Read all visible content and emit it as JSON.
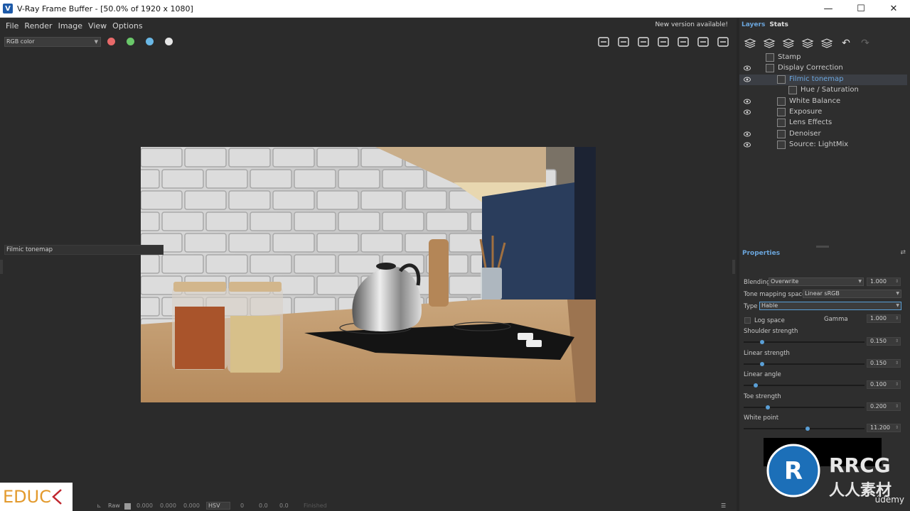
{
  "window": {
    "title": "V-Ray Frame Buffer - [50.0% of 1920 x 1080]",
    "minimize": "—",
    "maximize": "☐",
    "close": "✕"
  },
  "menu": [
    "File",
    "Render",
    "Image",
    "View",
    "Options"
  ],
  "update_notice": "New version available!",
  "toolbar": {
    "channel": "RGB color",
    "channel_dots": [
      {
        "name": "red-channel-button",
        "color": "#e86a6a"
      },
      {
        "name": "green-channel-button",
        "color": "#6ac86a"
      },
      {
        "name": "blue-channel-button",
        "color": "#6ab8e6"
      },
      {
        "name": "alpha-channel-button",
        "color": "#e6e6e6"
      }
    ],
    "tools": [
      "save-icon",
      "clear-image-icon",
      "region-render-icon",
      "compare-icon",
      "render-icon",
      "interactive-render-icon",
      "stop-render-icon"
    ]
  },
  "statusbar": {
    "mode": "Raw",
    "v1": "0.000",
    "v2": "0.000",
    "v3": "0.000",
    "colorspace": "HSV",
    "h": "0",
    "s": "0.0",
    "v": "0.0",
    "status": "Finished"
  },
  "educ_logo": "EDUC",
  "panel": {
    "tabs": [
      "Layers",
      "Stats"
    ],
    "layer_tools": [
      "add-layer-icon",
      "delete-layer-icon",
      "save-layers-icon",
      "load-layers-icon",
      "layers-list-icon",
      "undo-icon",
      "redo-icon"
    ],
    "layers": [
      {
        "name": "Stamp",
        "visible": false,
        "indent": 0,
        "icon": "stamp-layer-icon"
      },
      {
        "name": "Display Correction",
        "visible": true,
        "indent": 0,
        "icon": "display-correction-icon"
      },
      {
        "name": "Filmic tonemap",
        "visible": true,
        "indent": 1,
        "icon": "filmic-tonemap-icon",
        "selected": true
      },
      {
        "name": "Hue / Saturation",
        "visible": false,
        "indent": 2,
        "icon": "hue-saturation-icon"
      },
      {
        "name": "White Balance",
        "visible": true,
        "indent": 1,
        "icon": "white-balance-icon"
      },
      {
        "name": "Exposure",
        "visible": true,
        "indent": 1,
        "icon": "exposure-icon"
      },
      {
        "name": "Lens Effects",
        "visible": false,
        "indent": 1,
        "icon": "lens-effects-icon"
      },
      {
        "name": "Denoiser",
        "visible": true,
        "indent": 1,
        "icon": "denoiser-icon"
      },
      {
        "name": "Source: LightMix",
        "visible": true,
        "indent": 1,
        "icon": "lightmix-icon"
      }
    ]
  },
  "properties": {
    "title": "Properties",
    "layer_name": "Filmic tonemap",
    "blending_label": "Blending",
    "blending_value": "Overwrite",
    "blending_amount": "1.000",
    "tone_space_label": "Tone mapping space",
    "tone_space_value": "Linear sRGB",
    "type_label": "Type",
    "type_value": "Hable",
    "log_space_label": "Log space",
    "gamma_label": "Gamma",
    "gamma_value": "1.000",
    "sliders": [
      {
        "label": "Shoulder strength",
        "value": "0.150",
        "fraction": 0.15
      },
      {
        "label": "Linear strength",
        "value": "0.150",
        "fraction": 0.15
      },
      {
        "label": "Linear angle",
        "value": "0.100",
        "fraction": 0.1
      },
      {
        "label": "Toe strength",
        "value": "0.200",
        "fraction": 0.2
      },
      {
        "label": "White point",
        "value": "11.200",
        "fraction": 0.53
      }
    ]
  },
  "watermark": {
    "text1": "RRCG",
    "text2": "人人素材"
  },
  "udemy": "údemy"
}
